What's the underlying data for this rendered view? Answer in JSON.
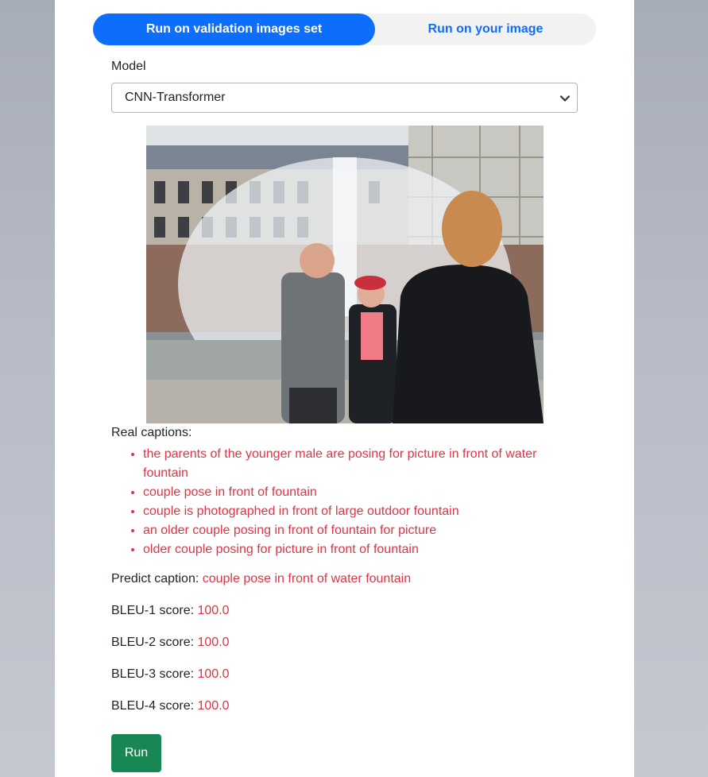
{
  "tabs": [
    {
      "label": "Run on validation images set",
      "active": true
    },
    {
      "label": "Run on your image",
      "active": false
    }
  ],
  "model": {
    "label": "Model",
    "selected": "CNN-Transformer"
  },
  "image": {
    "description_icon": "photo"
  },
  "real_captions": {
    "label": "Real captions:",
    "items": [
      "the parents of the younger male are posing for picture in front of water fountain",
      "couple pose in front of fountain",
      "couple is photographed in front of large outdoor fountain",
      "an older couple posing in front of fountain for picture",
      "older couple posing for picture in front of fountain"
    ]
  },
  "predict": {
    "label": "Predict caption:",
    "value": "couple pose in front of water fountain"
  },
  "scores": [
    {
      "label": "BLEU-1 score:",
      "value": "100.0"
    },
    {
      "label": "BLEU-2 score:",
      "value": "100.0"
    },
    {
      "label": "BLEU-3 score:",
      "value": "100.0"
    },
    {
      "label": "BLEU-4 score:",
      "value": "100.0"
    }
  ],
  "run_button": {
    "label": "Run"
  },
  "colors": {
    "primary": "#0d6efd",
    "danger": "#dc3545",
    "success": "#198754"
  }
}
